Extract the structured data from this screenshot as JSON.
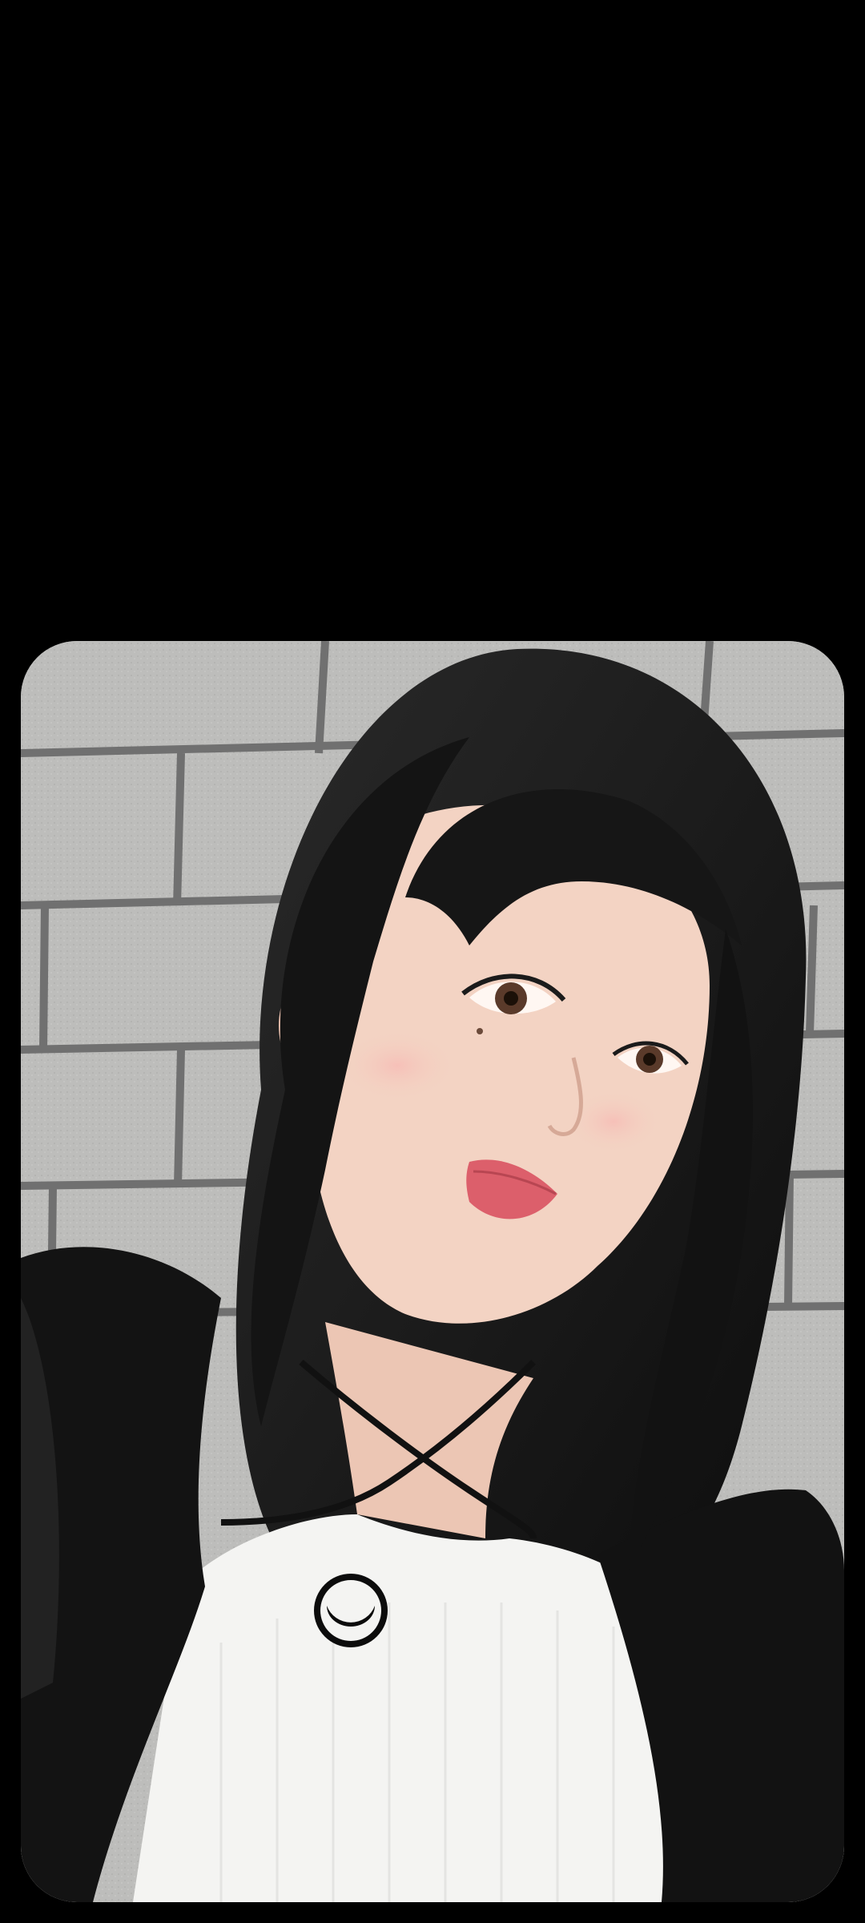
{
  "background_color": "#000000",
  "photo": {
    "description_icon": "portrait-photo",
    "wall_color": "#b9b9b7",
    "mortar_color": "#6e6e6c",
    "hair_color": "#151515",
    "skin_color": "#f3d3c3",
    "lip_color": "#d9606a",
    "top_color": "#f4f4f2",
    "cardigan_color": "#101010"
  }
}
